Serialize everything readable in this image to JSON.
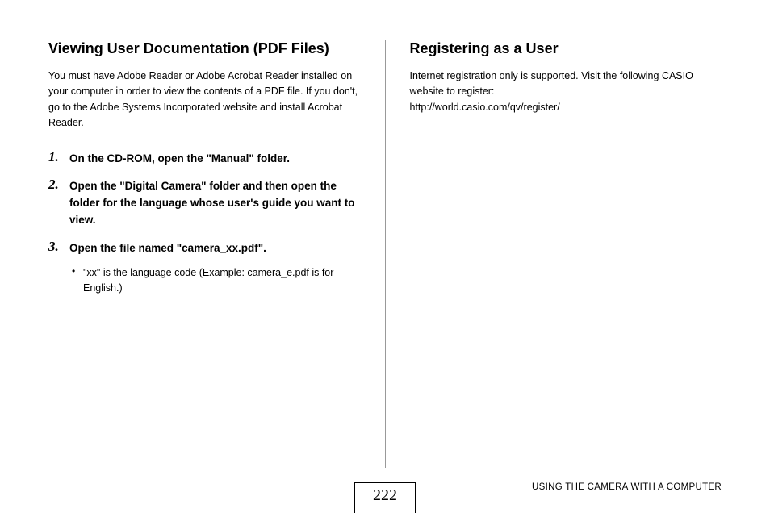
{
  "left": {
    "heading": "Viewing User Documentation (PDF Files)",
    "intro": "You must have Adobe Reader or Adobe Acrobat Reader installed on your computer in order to view the contents of a PDF file. If you don't, go to the Adobe Systems Incorporated website and install Acrobat Reader.",
    "steps": [
      {
        "num": "1.",
        "text": "On the CD-ROM, open the \"Manual\" folder."
      },
      {
        "num": "2.",
        "text": "Open the \"Digital Camera\" folder and then open the folder for the language whose user's guide you want to view."
      },
      {
        "num": "3.",
        "text": "Open the file named \"camera_xx.pdf\".",
        "sub": "\"xx\" is the language code (Example: camera_e.pdf is for English.)"
      }
    ]
  },
  "right": {
    "heading": "Registering as a User",
    "intro": "Internet registration only is supported. Visit the following CASIO website to register:\nhttp://world.casio.com/qv/register/"
  },
  "footer": {
    "page": "222",
    "section": "USING THE CAMERA WITH A COMPUTER"
  }
}
